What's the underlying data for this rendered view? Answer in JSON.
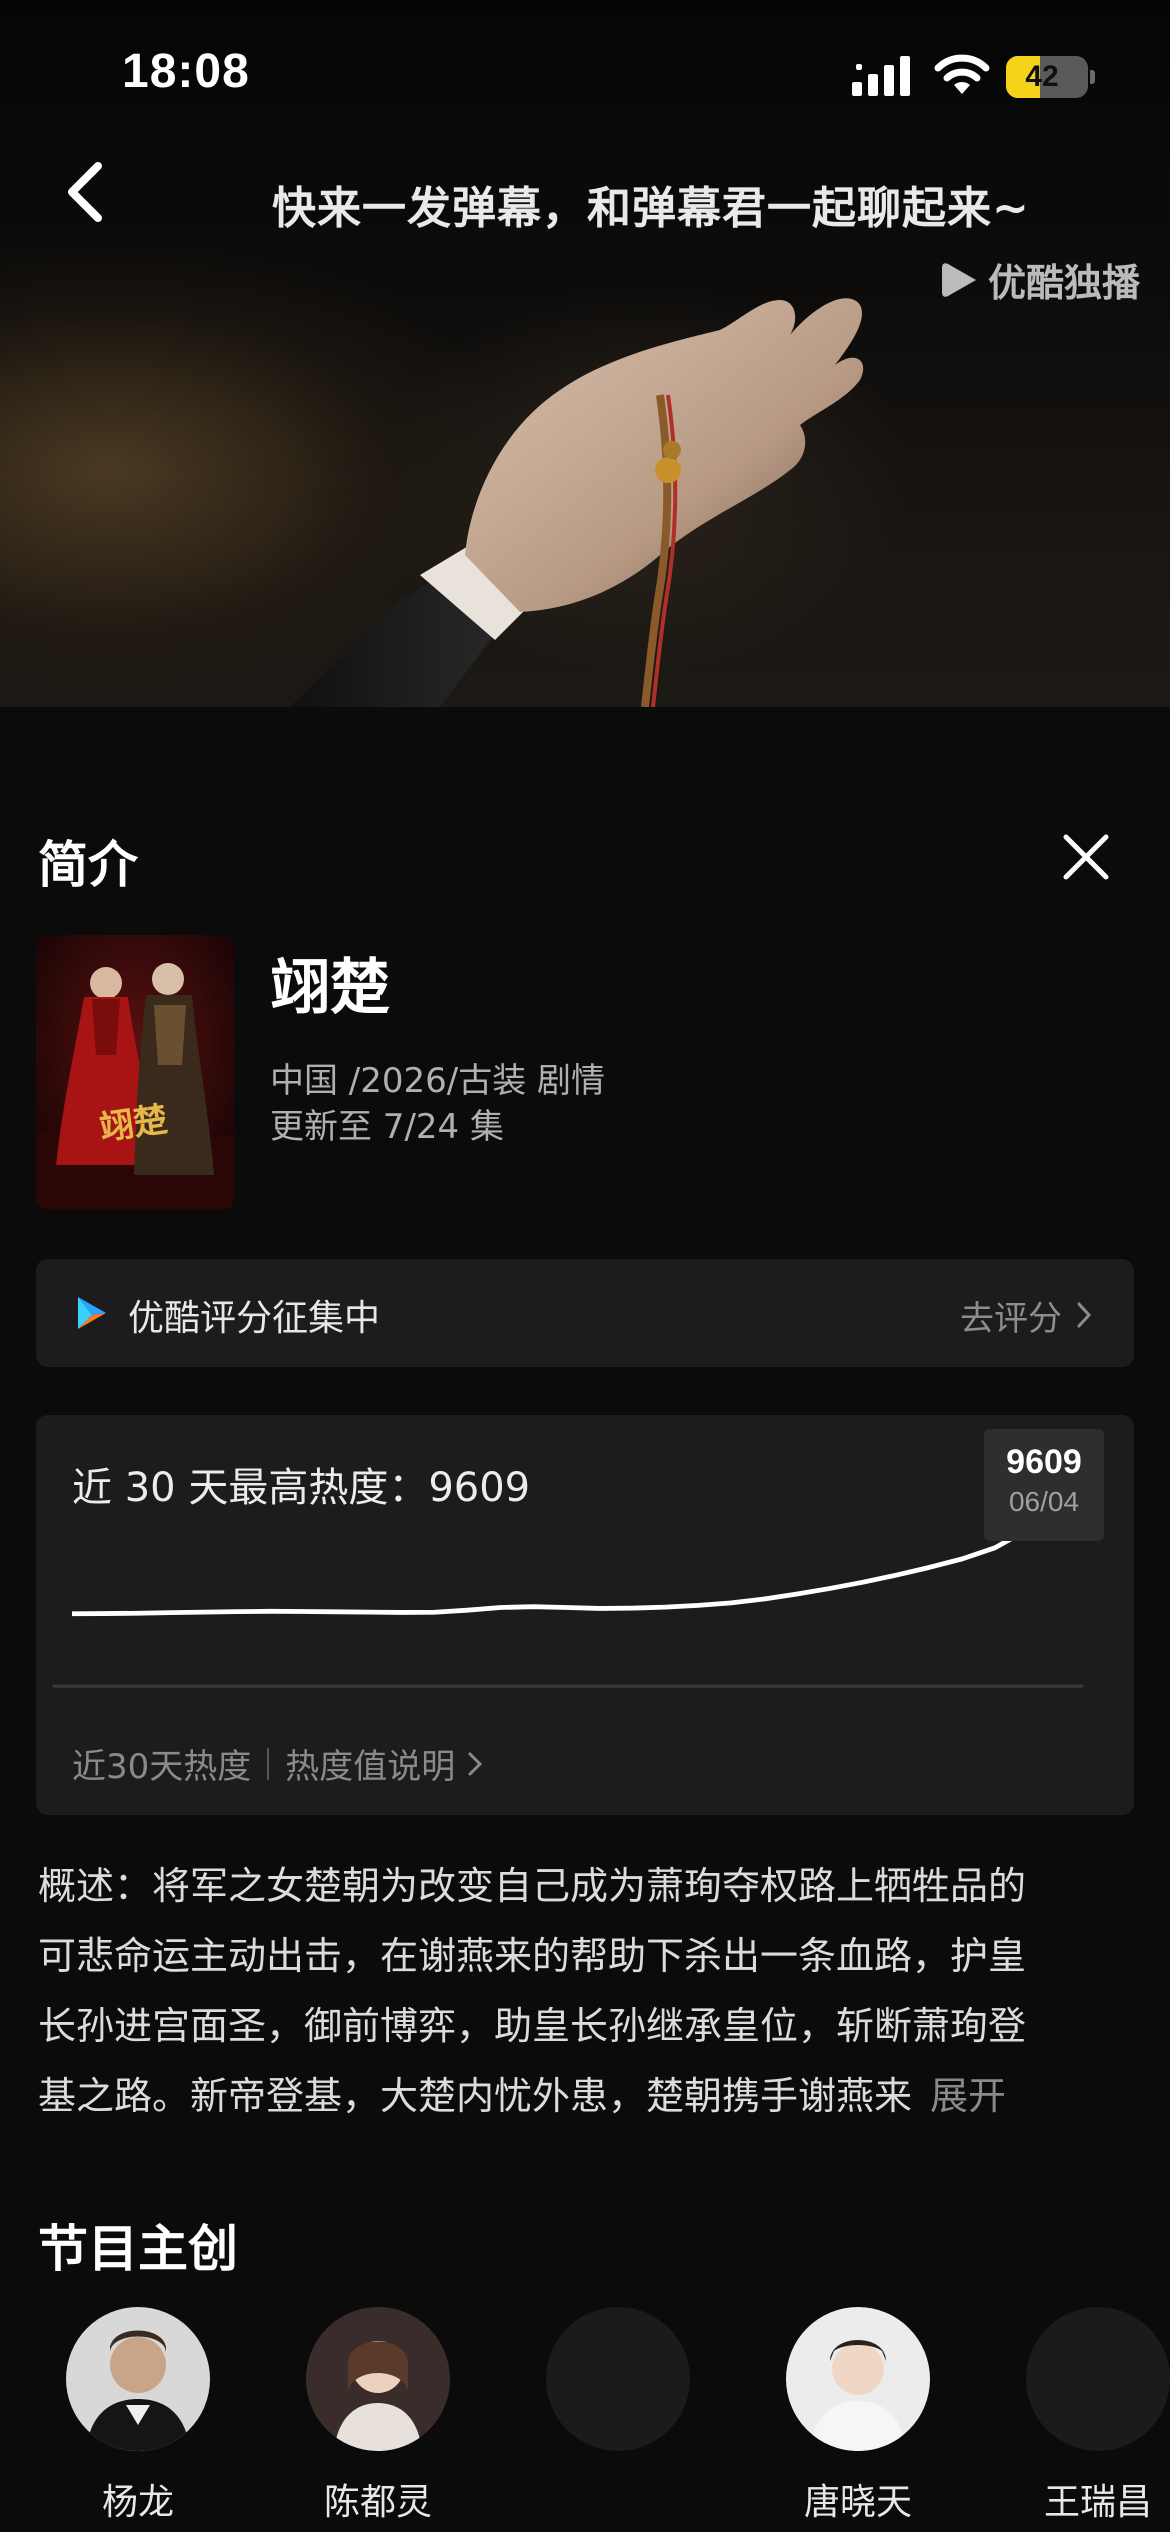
{
  "status_bar": {
    "time": "18:08",
    "battery": "42",
    "battery_fraction": 0.42
  },
  "player": {
    "danmaku_prompt": "快来一发弹幕，和弹幕君一起聊起来~",
    "exclusive_label": "优酷独播"
  },
  "intro": {
    "title": "简介",
    "show": {
      "title": "翊楚",
      "genre": "中国 /2026/古装 剧情",
      "update": "更新至 7/24 集",
      "poster_text": "翊楚"
    },
    "rating": {
      "label": "优酷评分征集中",
      "action": "去评分"
    },
    "heat": {
      "title": "近 30 天最高热度：9609",
      "peak_value": "9609",
      "peak_date": "06/04",
      "footer_label": "近30天热度",
      "footer_link": "热度值说明"
    },
    "synopsis": {
      "lines": [
        "概述：将军之女楚朝为改变自己成为萧珣夺权路上牺牲品的",
        "可悲命运主动出击，在谢燕来的帮助下杀出一条血路，护皇",
        "长孙进宫面圣，御前博弈，助皇长孙继承皇位，斩断萧珣登",
        "基之路。新帝登基，大楚内忧外患，楚朝携手谢燕来"
      ],
      "more": "展开"
    },
    "creators": {
      "title": "节目主创",
      "members": [
        {
          "name": "杨龙"
        },
        {
          "name": "陈都灵"
        },
        {
          "name": ""
        },
        {
          "name": "唐晓天"
        },
        {
          "name": "王瑞昌"
        }
      ]
    }
  },
  "chart_data": {
    "type": "line",
    "title": "近 30 天最高热度：9609",
    "xlabel": "",
    "ylabel": "",
    "x": [
      1,
      2,
      3,
      4,
      5,
      6,
      7,
      8,
      9,
      10,
      11,
      12,
      13,
      14,
      15,
      16,
      17,
      18,
      19,
      20,
      21,
      22,
      23,
      24,
      25,
      26,
      27,
      28,
      29,
      30
    ],
    "series": [
      {
        "values": [
          3600,
          3620,
          3640,
          3680,
          3720,
          3750,
          3770,
          3760,
          3740,
          3720,
          3700,
          3710,
          3850,
          4050,
          4100,
          4050,
          3980,
          4000,
          4070,
          4200,
          4380,
          4650,
          5000,
          5400,
          5850,
          6350,
          6900,
          7500,
          8300,
          9609
        ]
      }
    ],
    "highlight": {
      "value": 9609,
      "date": "06/04"
    },
    "grid": false,
    "colors": {
      "line": "#ffffff"
    }
  },
  "colors": {
    "accent": "#f5d31a",
    "youku_blue": "#2aa4ff",
    "youku_orange": "#ff7a1a"
  }
}
